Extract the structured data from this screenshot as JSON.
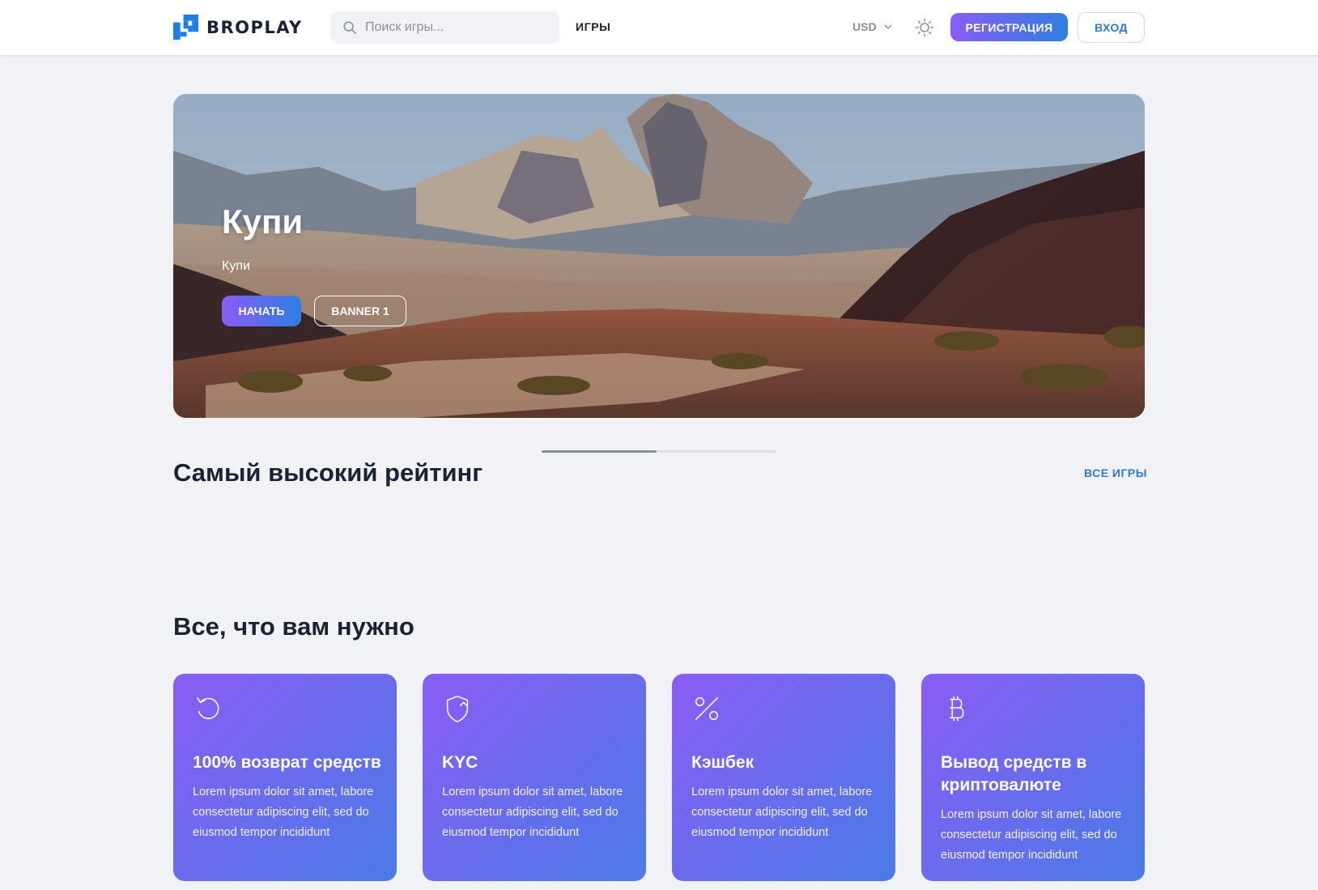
{
  "header": {
    "brand": "BROPLAY",
    "search_placeholder": "Поиск игры...",
    "nav_games": "ИГРЫ",
    "currency": "USD",
    "register_label": "РЕГИСТРАЦИЯ",
    "login_label": "ВХОД",
    "colors": {
      "accent_start": "#8a5cf5",
      "accent_end": "#2e7fe0",
      "link": "#2f7ad8"
    }
  },
  "banner": {
    "title": "Купи",
    "subtitle": "Купи",
    "start_label": "НАЧАТЬ",
    "banner_label": "BANNER 1",
    "slider_progress": 0.49
  },
  "top_rated": {
    "title": "Самый высокий рейтинг",
    "all_games_label": "ВСЕ ИГРЫ"
  },
  "features": {
    "title": "Все, что вам нужно",
    "cards": [
      {
        "icon": "refund-icon",
        "title": "100% возврат средств",
        "text": "Lorem ipsum dolor sit amet, labore consectetur adipiscing elit, sed do eiusmod tempor incididunt"
      },
      {
        "icon": "shield-check-icon",
        "title": "KYC",
        "text": "Lorem ipsum dolor sit amet, labore consectetur adipiscing elit, sed do eiusmod tempor incididunt"
      },
      {
        "icon": "percent-icon",
        "title": "Кэшбек",
        "text": "Lorem ipsum dolor sit amet, labore consectetur adipiscing elit, sed do eiusmod tempor incididunt"
      },
      {
        "icon": "bitcoin-icon",
        "title": "Вывод средств в криптовалюте",
        "text": "Lorem ipsum dolor sit amet, labore consectetur adipiscing elit, sed do eiusmod tempor incididunt"
      }
    ]
  }
}
